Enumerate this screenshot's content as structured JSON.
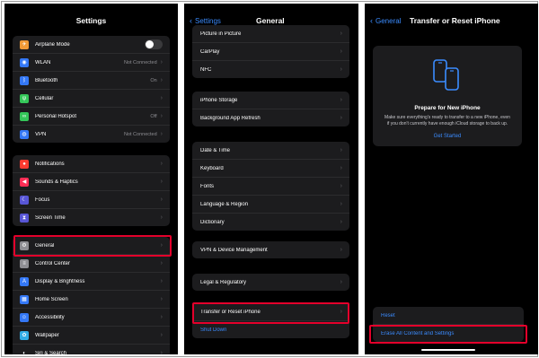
{
  "screen1": {
    "title": "Settings",
    "group1": [
      {
        "label": "Airplane Mode",
        "icon": "airplane-icon",
        "color": "#f09a37",
        "toggle": true
      },
      {
        "label": "WLAN",
        "icon": "wifi-icon",
        "color": "#3478f6",
        "value": "Not Connected"
      },
      {
        "label": "Bluetooth",
        "icon": "bluetooth-icon",
        "color": "#3478f6",
        "value": "On"
      },
      {
        "label": "Cellular",
        "icon": "antenna-icon",
        "color": "#34c759"
      },
      {
        "label": "Personal Hotspot",
        "icon": "hotspot-icon",
        "color": "#34c759",
        "value": "Off"
      },
      {
        "label": "VPN",
        "icon": "globe-icon",
        "color": "#3478f6",
        "value": "Not Connected"
      }
    ],
    "group2": [
      {
        "label": "Notifications",
        "icon": "bell-icon",
        "color": "#ff3b30"
      },
      {
        "label": "Sounds & Haptics",
        "icon": "speaker-icon",
        "color": "#ff2d55"
      },
      {
        "label": "Focus",
        "icon": "moon-icon",
        "color": "#5856d6"
      },
      {
        "label": "Screen Time",
        "icon": "hourglass-icon",
        "color": "#5856d6"
      }
    ],
    "group3": [
      {
        "label": "General",
        "icon": "gear-icon",
        "color": "#8e8e93"
      },
      {
        "label": "Control Center",
        "icon": "switches-icon",
        "color": "#8e8e93"
      },
      {
        "label": "Display & Brightness",
        "icon": "text-size-icon",
        "color": "#3478f6"
      },
      {
        "label": "Home Screen",
        "icon": "grid-icon",
        "color": "#3478f6"
      },
      {
        "label": "Accessibility",
        "icon": "accessibility-icon",
        "color": "#3478f6"
      },
      {
        "label": "Wallpaper",
        "icon": "flower-icon",
        "color": "#32ade6"
      },
      {
        "label": "Siri & Search",
        "icon": "siri-icon",
        "color": "#1c1c1e"
      }
    ]
  },
  "screen2": {
    "back_label": "Settings",
    "title": "General",
    "group1": [
      "Picture in Picture",
      "CarPlay",
      "NFC"
    ],
    "group2": [
      "iPhone Storage",
      "Background App Refresh"
    ],
    "group3": [
      "Date & Time",
      "Keyboard",
      "Fonts",
      "Language & Region",
      "Dictionary"
    ],
    "group4": [
      "VPN & Device Management"
    ],
    "group5": [
      "Legal & Regulatory"
    ],
    "group6": [
      "Transfer or Reset iPhone",
      "Shut Down"
    ]
  },
  "screen3": {
    "back_label": "General",
    "title": "Transfer or Reset iPhone",
    "card": {
      "title": "Prepare for New iPhone",
      "description": "Make sure everything's ready to transfer to a new iPhone, even if you don't currently have enough iCloud storage to back up.",
      "link": "Get Started"
    },
    "reset_label": "Reset",
    "erase_label": "Erase All Content and Settings"
  },
  "colors": {
    "accent": "#3b8cff",
    "highlight": "#e4002b",
    "cell": "#1c1c1e",
    "background": "#000000"
  }
}
